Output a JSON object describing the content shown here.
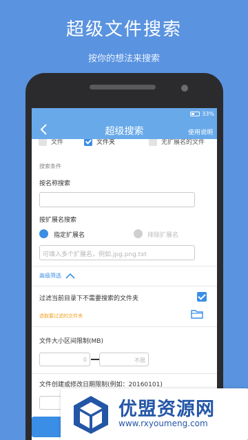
{
  "promo": {
    "title": "超级文件搜索",
    "subtitle": "按你的想法来搜索"
  },
  "status_bar": {
    "battery": "33%"
  },
  "app_bar": {
    "back_icon": "chevron-left-icon",
    "title": "超级搜索",
    "help": "使用说明"
  },
  "file_types": [
    {
      "label": "文件",
      "checked": false
    },
    {
      "label": "文件夹",
      "checked": true
    },
    {
      "label": "无扩展名的文件",
      "checked": false
    }
  ],
  "search_conditions": {
    "section_label": "搜索条件",
    "by_name_label": "按名称搜索",
    "name_value": "",
    "by_ext_label": "按扩展名搜索",
    "include_ext": "指定扩展名",
    "exclude_ext": "排除扩展名",
    "ext_placeholder": "可填入多个扩展名，例如.jpg.png.txt"
  },
  "advanced": {
    "label": "高级筛选",
    "filter_dirs_text": "过滤当前目录下不需要搜索的文件夹",
    "filter_dirs_checked": true,
    "select_dirs_link": "选取要过滤的文件夹",
    "size_label": "文件大小区间限制(MB)",
    "size_min": "0",
    "size_max": "不限",
    "date_label": "文件创建或修改日期限制(例如：20160101)"
  },
  "watermark": {
    "name": "优盟资源网",
    "url": "www.rxyoumeng.com"
  },
  "colors": {
    "background": "#5a93e0",
    "app_bar": "#68a9ea",
    "accent": "#3a8ee6",
    "link_orange": "#f0a01e",
    "watermark_blue": "#2456a6"
  }
}
